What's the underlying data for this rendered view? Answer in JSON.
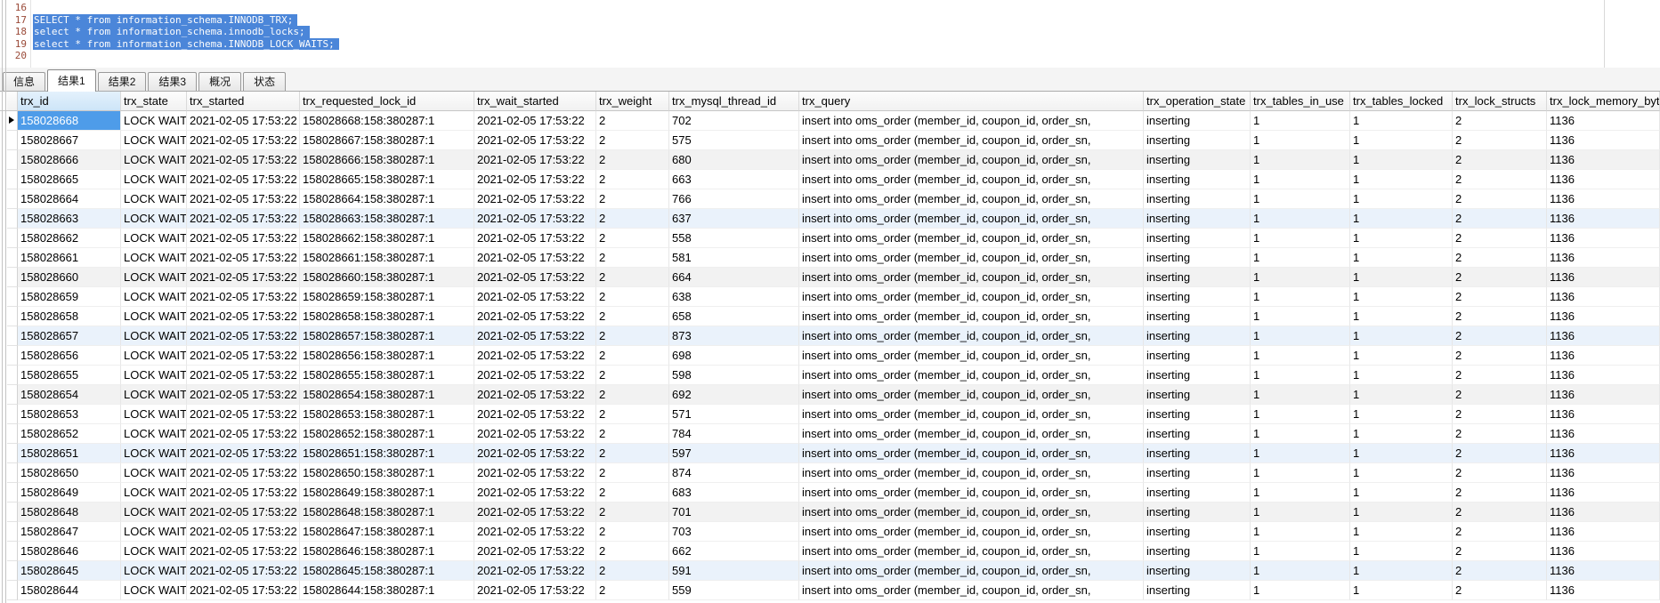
{
  "editor": {
    "lines": [
      {
        "number": "16",
        "text": "",
        "selected": false
      },
      {
        "number": "17",
        "text": "SELECT * from information_schema.INNODB_TRX;",
        "selected": true
      },
      {
        "number": "18",
        "text": "select * from information_schema.innodb_locks;",
        "selected": true
      },
      {
        "number": "19",
        "text": "select * from information_schema.INNODB_LOCK_WAITS;",
        "selected": true
      },
      {
        "number": "20",
        "text": "",
        "selected": false
      }
    ]
  },
  "tabs": [
    {
      "id": "info",
      "label": "信息",
      "active": false
    },
    {
      "id": "result1",
      "label": "结果1",
      "active": true
    },
    {
      "id": "result2",
      "label": "结果2",
      "active": false
    },
    {
      "id": "result3",
      "label": "结果3",
      "active": false
    },
    {
      "id": "profile",
      "label": "概况",
      "active": false
    },
    {
      "id": "status",
      "label": "状态",
      "active": false
    }
  ],
  "grid": {
    "columns": [
      {
        "key": "trx_id",
        "label": "trx_id"
      },
      {
        "key": "trx_state",
        "label": "trx_state"
      },
      {
        "key": "trx_started",
        "label": "trx_started"
      },
      {
        "key": "trx_requested_lock_id",
        "label": "trx_requested_lock_id"
      },
      {
        "key": "trx_wait_started",
        "label": "trx_wait_started"
      },
      {
        "key": "trx_weight",
        "label": "trx_weight"
      },
      {
        "key": "trx_mysql_thread_id",
        "label": "trx_mysql_thread_id"
      },
      {
        "key": "trx_query",
        "label": "trx_query"
      },
      {
        "key": "trx_operation_state",
        "label": "trx_operation_state"
      },
      {
        "key": "trx_tables_in_use",
        "label": "trx_tables_in_use"
      },
      {
        "key": "trx_tables_locked",
        "label": "trx_tables_locked"
      },
      {
        "key": "trx_lock_structs",
        "label": "trx_lock_structs"
      },
      {
        "key": "trx_lock_memory_bytes",
        "label": "trx_lock_memory_bytes"
      }
    ],
    "selection": {
      "row_index": 0,
      "column": "trx_id"
    },
    "rows": [
      {
        "trx_id": "158028668",
        "trx_state": "LOCK WAIT",
        "trx_started": "2021-02-05 17:53:22",
        "trx_requested_lock_id": "158028668:158:380287:1",
        "trx_wait_started": "2021-02-05 17:53:22",
        "trx_weight": "2",
        "trx_mysql_thread_id": "702",
        "trx_query": "insert into oms_order (member_id, coupon_id, order_sn,",
        "trx_operation_state": "inserting",
        "trx_tables_in_use": "1",
        "trx_tables_locked": "1",
        "trx_lock_structs": "2",
        "trx_lock_memory_bytes": "1136"
      },
      {
        "trx_id": "158028667",
        "trx_state": "LOCK WAIT",
        "trx_started": "2021-02-05 17:53:22",
        "trx_requested_lock_id": "158028667:158:380287:1",
        "trx_wait_started": "2021-02-05 17:53:22",
        "trx_weight": "2",
        "trx_mysql_thread_id": "575",
        "trx_query": "insert into oms_order (member_id, coupon_id, order_sn,",
        "trx_operation_state": "inserting",
        "trx_tables_in_use": "1",
        "trx_tables_locked": "1",
        "trx_lock_structs": "2",
        "trx_lock_memory_bytes": "1136"
      },
      {
        "trx_id": "158028666",
        "trx_state": "LOCK WAIT",
        "trx_started": "2021-02-05 17:53:22",
        "trx_requested_lock_id": "158028666:158:380287:1",
        "trx_wait_started": "2021-02-05 17:53:22",
        "trx_weight": "2",
        "trx_mysql_thread_id": "680",
        "trx_query": "insert into oms_order (member_id, coupon_id, order_sn,",
        "trx_operation_state": "inserting",
        "trx_tables_in_use": "1",
        "trx_tables_locked": "1",
        "trx_lock_structs": "2",
        "trx_lock_memory_bytes": "1136"
      },
      {
        "trx_id": "158028665",
        "trx_state": "LOCK WAIT",
        "trx_started": "2021-02-05 17:53:22",
        "trx_requested_lock_id": "158028665:158:380287:1",
        "trx_wait_started": "2021-02-05 17:53:22",
        "trx_weight": "2",
        "trx_mysql_thread_id": "663",
        "trx_query": "insert into oms_order (member_id, coupon_id, order_sn,",
        "trx_operation_state": "inserting",
        "trx_tables_in_use": "1",
        "trx_tables_locked": "1",
        "trx_lock_structs": "2",
        "trx_lock_memory_bytes": "1136"
      },
      {
        "trx_id": "158028664",
        "trx_state": "LOCK WAIT",
        "trx_started": "2021-02-05 17:53:22",
        "trx_requested_lock_id": "158028664:158:380287:1",
        "trx_wait_started": "2021-02-05 17:53:22",
        "trx_weight": "2",
        "trx_mysql_thread_id": "766",
        "trx_query": "insert into oms_order (member_id, coupon_id, order_sn,",
        "trx_operation_state": "inserting",
        "trx_tables_in_use": "1",
        "trx_tables_locked": "1",
        "trx_lock_structs": "2",
        "trx_lock_memory_bytes": "1136"
      },
      {
        "trx_id": "158028663",
        "trx_state": "LOCK WAIT",
        "trx_started": "2021-02-05 17:53:22",
        "trx_requested_lock_id": "158028663:158:380287:1",
        "trx_wait_started": "2021-02-05 17:53:22",
        "trx_weight": "2",
        "trx_mysql_thread_id": "637",
        "trx_query": "insert into oms_order (member_id, coupon_id, order_sn,",
        "trx_operation_state": "inserting",
        "trx_tables_in_use": "1",
        "trx_tables_locked": "1",
        "trx_lock_structs": "2",
        "trx_lock_memory_bytes": "1136"
      },
      {
        "trx_id": "158028662",
        "trx_state": "LOCK WAIT",
        "trx_started": "2021-02-05 17:53:22",
        "trx_requested_lock_id": "158028662:158:380287:1",
        "trx_wait_started": "2021-02-05 17:53:22",
        "trx_weight": "2",
        "trx_mysql_thread_id": "558",
        "trx_query": "insert into oms_order (member_id, coupon_id, order_sn,",
        "trx_operation_state": "inserting",
        "trx_tables_in_use": "1",
        "trx_tables_locked": "1",
        "trx_lock_structs": "2",
        "trx_lock_memory_bytes": "1136"
      },
      {
        "trx_id": "158028661",
        "trx_state": "LOCK WAIT",
        "trx_started": "2021-02-05 17:53:22",
        "trx_requested_lock_id": "158028661:158:380287:1",
        "trx_wait_started": "2021-02-05 17:53:22",
        "trx_weight": "2",
        "trx_mysql_thread_id": "581",
        "trx_query": "insert into oms_order (member_id, coupon_id, order_sn,",
        "trx_operation_state": "inserting",
        "trx_tables_in_use": "1",
        "trx_tables_locked": "1",
        "trx_lock_structs": "2",
        "trx_lock_memory_bytes": "1136"
      },
      {
        "trx_id": "158028660",
        "trx_state": "LOCK WAIT",
        "trx_started": "2021-02-05 17:53:22",
        "trx_requested_lock_id": "158028660:158:380287:1",
        "trx_wait_started": "2021-02-05 17:53:22",
        "trx_weight": "2",
        "trx_mysql_thread_id": "664",
        "trx_query": "insert into oms_order (member_id, coupon_id, order_sn,",
        "trx_operation_state": "inserting",
        "trx_tables_in_use": "1",
        "trx_tables_locked": "1",
        "trx_lock_structs": "2",
        "trx_lock_memory_bytes": "1136"
      },
      {
        "trx_id": "158028659",
        "trx_state": "LOCK WAIT",
        "trx_started": "2021-02-05 17:53:22",
        "trx_requested_lock_id": "158028659:158:380287:1",
        "trx_wait_started": "2021-02-05 17:53:22",
        "trx_weight": "2",
        "trx_mysql_thread_id": "638",
        "trx_query": "insert into oms_order (member_id, coupon_id, order_sn,",
        "trx_operation_state": "inserting",
        "trx_tables_in_use": "1",
        "trx_tables_locked": "1",
        "trx_lock_structs": "2",
        "trx_lock_memory_bytes": "1136"
      },
      {
        "trx_id": "158028658",
        "trx_state": "LOCK WAIT",
        "trx_started": "2021-02-05 17:53:22",
        "trx_requested_lock_id": "158028658:158:380287:1",
        "trx_wait_started": "2021-02-05 17:53:22",
        "trx_weight": "2",
        "trx_mysql_thread_id": "658",
        "trx_query": "insert into oms_order (member_id, coupon_id, order_sn,",
        "trx_operation_state": "inserting",
        "trx_tables_in_use": "1",
        "trx_tables_locked": "1",
        "trx_lock_structs": "2",
        "trx_lock_memory_bytes": "1136"
      },
      {
        "trx_id": "158028657",
        "trx_state": "LOCK WAIT",
        "trx_started": "2021-02-05 17:53:22",
        "trx_requested_lock_id": "158028657:158:380287:1",
        "trx_wait_started": "2021-02-05 17:53:22",
        "trx_weight": "2",
        "trx_mysql_thread_id": "873",
        "trx_query": "insert into oms_order (member_id, coupon_id, order_sn,",
        "trx_operation_state": "inserting",
        "trx_tables_in_use": "1",
        "trx_tables_locked": "1",
        "trx_lock_structs": "2",
        "trx_lock_memory_bytes": "1136"
      },
      {
        "trx_id": "158028656",
        "trx_state": "LOCK WAIT",
        "trx_started": "2021-02-05 17:53:22",
        "trx_requested_lock_id": "158028656:158:380287:1",
        "trx_wait_started": "2021-02-05 17:53:22",
        "trx_weight": "2",
        "trx_mysql_thread_id": "698",
        "trx_query": "insert into oms_order (member_id, coupon_id, order_sn,",
        "trx_operation_state": "inserting",
        "trx_tables_in_use": "1",
        "trx_tables_locked": "1",
        "trx_lock_structs": "2",
        "trx_lock_memory_bytes": "1136"
      },
      {
        "trx_id": "158028655",
        "trx_state": "LOCK WAIT",
        "trx_started": "2021-02-05 17:53:22",
        "trx_requested_lock_id": "158028655:158:380287:1",
        "trx_wait_started": "2021-02-05 17:53:22",
        "trx_weight": "2",
        "trx_mysql_thread_id": "598",
        "trx_query": "insert into oms_order (member_id, coupon_id, order_sn,",
        "trx_operation_state": "inserting",
        "trx_tables_in_use": "1",
        "trx_tables_locked": "1",
        "trx_lock_structs": "2",
        "trx_lock_memory_bytes": "1136"
      },
      {
        "trx_id": "158028654",
        "trx_state": "LOCK WAIT",
        "trx_started": "2021-02-05 17:53:22",
        "trx_requested_lock_id": "158028654:158:380287:1",
        "trx_wait_started": "2021-02-05 17:53:22",
        "trx_weight": "2",
        "trx_mysql_thread_id": "692",
        "trx_query": "insert into oms_order (member_id, coupon_id, order_sn,",
        "trx_operation_state": "inserting",
        "trx_tables_in_use": "1",
        "trx_tables_locked": "1",
        "trx_lock_structs": "2",
        "trx_lock_memory_bytes": "1136"
      },
      {
        "trx_id": "158028653",
        "trx_state": "LOCK WAIT",
        "trx_started": "2021-02-05 17:53:22",
        "trx_requested_lock_id": "158028653:158:380287:1",
        "trx_wait_started": "2021-02-05 17:53:22",
        "trx_weight": "2",
        "trx_mysql_thread_id": "571",
        "trx_query": "insert into oms_order (member_id, coupon_id, order_sn,",
        "trx_operation_state": "inserting",
        "trx_tables_in_use": "1",
        "trx_tables_locked": "1",
        "trx_lock_structs": "2",
        "trx_lock_memory_bytes": "1136"
      },
      {
        "trx_id": "158028652",
        "trx_state": "LOCK WAIT",
        "trx_started": "2021-02-05 17:53:22",
        "trx_requested_lock_id": "158028652:158:380287:1",
        "trx_wait_started": "2021-02-05 17:53:22",
        "trx_weight": "2",
        "trx_mysql_thread_id": "784",
        "trx_query": "insert into oms_order (member_id, coupon_id, order_sn,",
        "trx_operation_state": "inserting",
        "trx_tables_in_use": "1",
        "trx_tables_locked": "1",
        "trx_lock_structs": "2",
        "trx_lock_memory_bytes": "1136"
      },
      {
        "trx_id": "158028651",
        "trx_state": "LOCK WAIT",
        "trx_started": "2021-02-05 17:53:22",
        "trx_requested_lock_id": "158028651:158:380287:1",
        "trx_wait_started": "2021-02-05 17:53:22",
        "trx_weight": "2",
        "trx_mysql_thread_id": "597",
        "trx_query": "insert into oms_order (member_id, coupon_id, order_sn,",
        "trx_operation_state": "inserting",
        "trx_tables_in_use": "1",
        "trx_tables_locked": "1",
        "trx_lock_structs": "2",
        "trx_lock_memory_bytes": "1136"
      },
      {
        "trx_id": "158028650",
        "trx_state": "LOCK WAIT",
        "trx_started": "2021-02-05 17:53:22",
        "trx_requested_lock_id": "158028650:158:380287:1",
        "trx_wait_started": "2021-02-05 17:53:22",
        "trx_weight": "2",
        "trx_mysql_thread_id": "874",
        "trx_query": "insert into oms_order (member_id, coupon_id, order_sn,",
        "trx_operation_state": "inserting",
        "trx_tables_in_use": "1",
        "trx_tables_locked": "1",
        "trx_lock_structs": "2",
        "trx_lock_memory_bytes": "1136"
      },
      {
        "trx_id": "158028649",
        "trx_state": "LOCK WAIT",
        "trx_started": "2021-02-05 17:53:22",
        "trx_requested_lock_id": "158028649:158:380287:1",
        "trx_wait_started": "2021-02-05 17:53:22",
        "trx_weight": "2",
        "trx_mysql_thread_id": "683",
        "trx_query": "insert into oms_order (member_id, coupon_id, order_sn,",
        "trx_operation_state": "inserting",
        "trx_tables_in_use": "1",
        "trx_tables_locked": "1",
        "trx_lock_structs": "2",
        "trx_lock_memory_bytes": "1136"
      },
      {
        "trx_id": "158028648",
        "trx_state": "LOCK WAIT",
        "trx_started": "2021-02-05 17:53:22",
        "trx_requested_lock_id": "158028648:158:380287:1",
        "trx_wait_started": "2021-02-05 17:53:22",
        "trx_weight": "2",
        "trx_mysql_thread_id": "701",
        "trx_query": "insert into oms_order (member_id, coupon_id, order_sn,",
        "trx_operation_state": "inserting",
        "trx_tables_in_use": "1",
        "trx_tables_locked": "1",
        "trx_lock_structs": "2",
        "trx_lock_memory_bytes": "1136"
      },
      {
        "trx_id": "158028647",
        "trx_state": "LOCK WAIT",
        "trx_started": "2021-02-05 17:53:22",
        "trx_requested_lock_id": "158028647:158:380287:1",
        "trx_wait_started": "2021-02-05 17:53:22",
        "trx_weight": "2",
        "trx_mysql_thread_id": "703",
        "trx_query": "insert into oms_order (member_id, coupon_id, order_sn,",
        "trx_operation_state": "inserting",
        "trx_tables_in_use": "1",
        "trx_tables_locked": "1",
        "trx_lock_structs": "2",
        "trx_lock_memory_bytes": "1136"
      },
      {
        "trx_id": "158028646",
        "trx_state": "LOCK WAIT",
        "trx_started": "2021-02-05 17:53:22",
        "trx_requested_lock_id": "158028646:158:380287:1",
        "trx_wait_started": "2021-02-05 17:53:22",
        "trx_weight": "2",
        "trx_mysql_thread_id": "662",
        "trx_query": "insert into oms_order (member_id, coupon_id, order_sn,",
        "trx_operation_state": "inserting",
        "trx_tables_in_use": "1",
        "trx_tables_locked": "1",
        "trx_lock_structs": "2",
        "trx_lock_memory_bytes": "1136"
      },
      {
        "trx_id": "158028645",
        "trx_state": "LOCK WAIT",
        "trx_started": "2021-02-05 17:53:22",
        "trx_requested_lock_id": "158028645:158:380287:1",
        "trx_wait_started": "2021-02-05 17:53:22",
        "trx_weight": "2",
        "trx_mysql_thread_id": "591",
        "trx_query": "insert into oms_order (member_id, coupon_id, order_sn,",
        "trx_operation_state": "inserting",
        "trx_tables_in_use": "1",
        "trx_tables_locked": "1",
        "trx_lock_structs": "2",
        "trx_lock_memory_bytes": "1136"
      },
      {
        "trx_id": "158028644",
        "trx_state": "LOCK WAIT",
        "trx_started": "2021-02-05 17:53:22",
        "trx_requested_lock_id": "158028644:158:380287:1",
        "trx_wait_started": "2021-02-05 17:53:22",
        "trx_weight": "2",
        "trx_mysql_thread_id": "559",
        "trx_query": "insert into oms_order (member_id, coupon_id, order_sn,",
        "trx_operation_state": "inserting",
        "trx_tables_in_use": "1",
        "trx_tables_locked": "1",
        "trx_lock_structs": "2",
        "trx_lock_memory_bytes": "1136"
      }
    ]
  },
  "colors": {
    "cell_selection": "#4e9ce9",
    "editor_selection": "#4b86d9",
    "selected_header": "#cde5f8",
    "stripe_gray": "#f2f2f2",
    "stripe_blue": "#eaf2fb"
  }
}
